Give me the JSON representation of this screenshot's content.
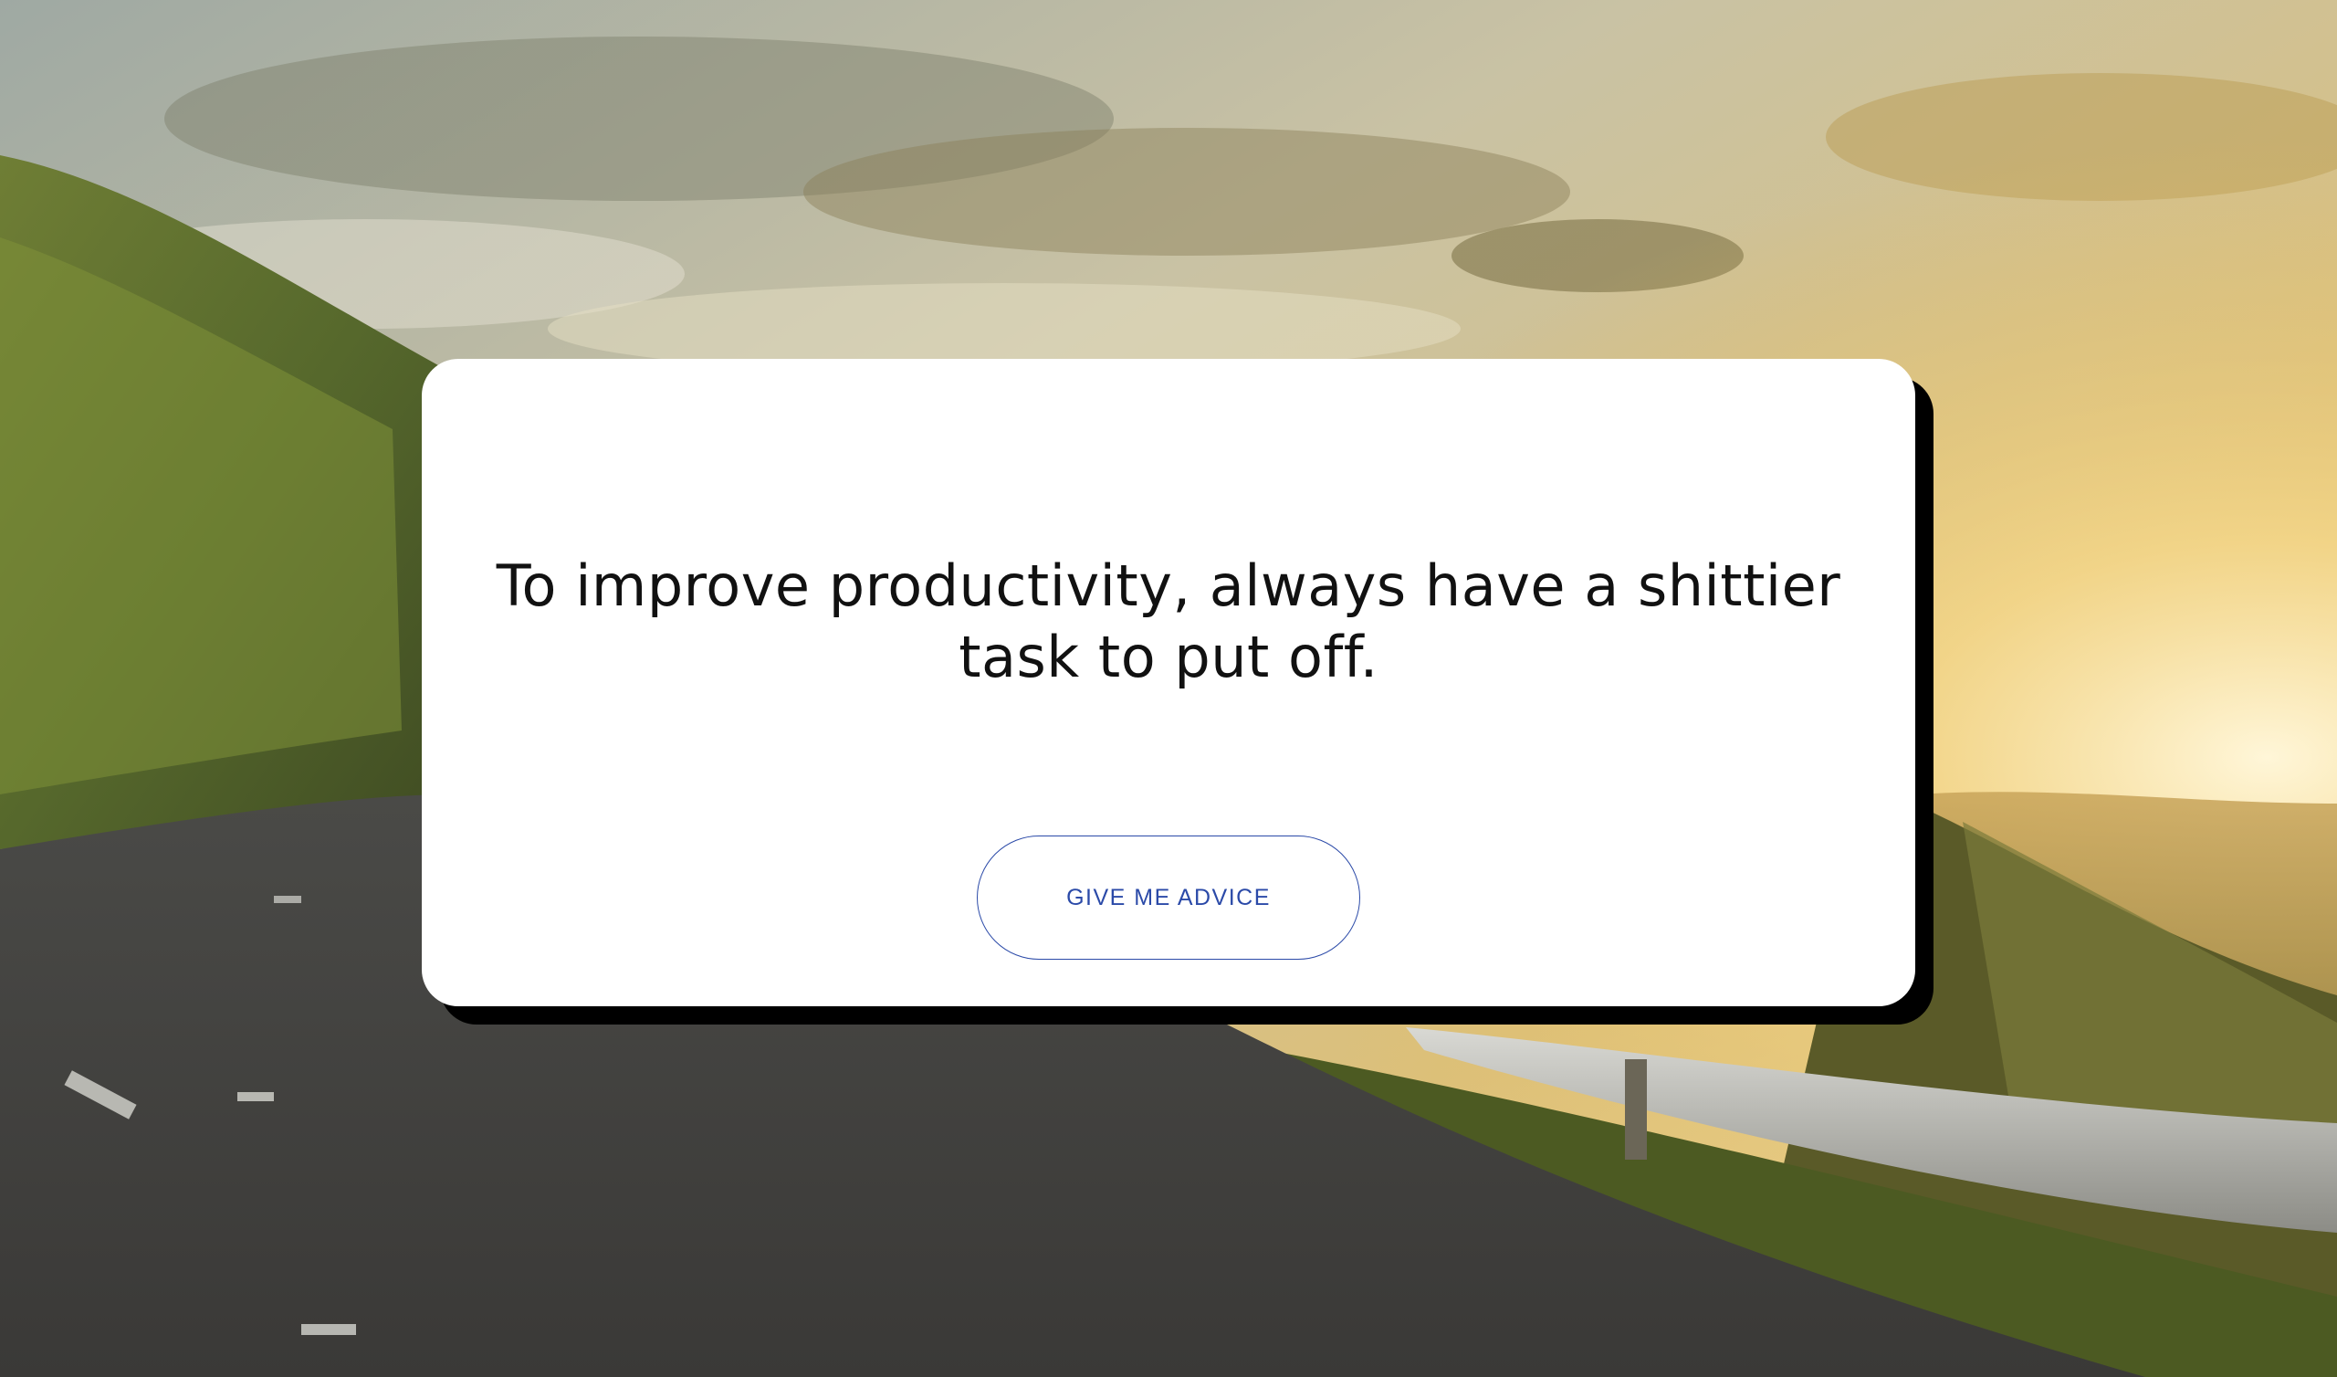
{
  "advice_card": {
    "advice_text": "To improve productivity, always have a shittier task to put off.",
    "button_label": "GIVE ME ADVICE"
  },
  "colors": {
    "card_background": "#ffffff",
    "card_shadow": "#000000",
    "button_border": "#2b4aa8",
    "button_text": "#2b4aa8",
    "advice_text": "#111111"
  }
}
